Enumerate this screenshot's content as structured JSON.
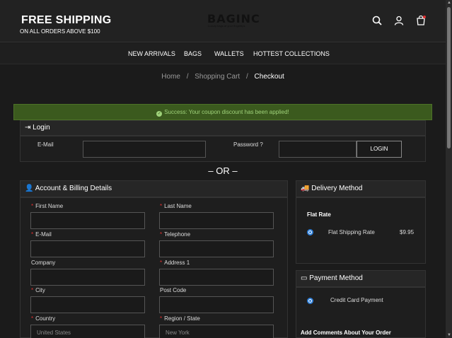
{
  "header": {
    "shipping_title": "FREE SHIPPING",
    "shipping_sub": "ON ALL ORDERS ABOVE $100",
    "logo": "BAGINC",
    "logo_tagline": "Luxury bags at your fingertips",
    "icons": [
      "search-icon",
      "user-icon",
      "cart-icon"
    ]
  },
  "nav": {
    "items": [
      "NEW ARRIVALS",
      "BAGS",
      "WALLETS",
      "HOTTEST COLLECTIONS"
    ]
  },
  "breadcrumb": {
    "items": [
      "Home",
      "Shopping Cart",
      "Checkout"
    ],
    "separator": "/"
  },
  "alert": {
    "text": "Success: Your coupon discount has been applied!"
  },
  "login": {
    "title": "Login",
    "email_label": "E-Mail",
    "password_label": "Password",
    "button": "LOGIN"
  },
  "or_text": "– OR –",
  "billing": {
    "title": "Account & Billing Details",
    "first_name": "First Name",
    "last_name": "Last Name",
    "email": "E-Mail",
    "telephone": "Telephone",
    "company": "Company",
    "address1": "Address 1",
    "city": "City",
    "post_code": "Post Code",
    "country": "Country",
    "country_value": "United States",
    "region": "Region / State",
    "region_value": "New York"
  },
  "delivery": {
    "title": "Delivery Method",
    "option_group": "Flat Rate",
    "option_label": "Flat Shipping Rate",
    "option_price": "$9.95"
  },
  "payment": {
    "title": "Payment Method",
    "option_label": "Credit Card Payment",
    "comments_label": "Add Comments About Your Order"
  },
  "colors": {
    "alert_bg": "#3b5a1e",
    "alert_text": "#9fd27a",
    "required": "#e03030",
    "radio": "#2f7fd8"
  }
}
